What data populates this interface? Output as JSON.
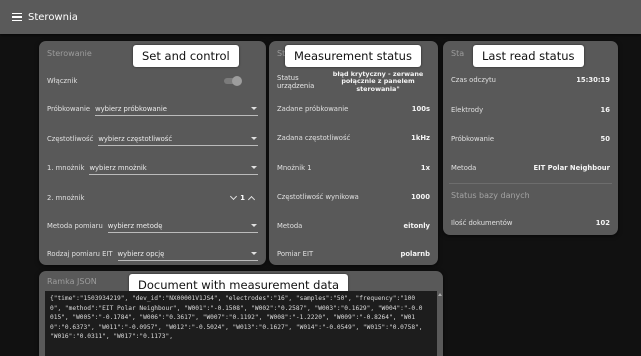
{
  "app": {
    "title": "Sterownia",
    "menu_icon": "hamburger-menu-icon"
  },
  "control": {
    "title": "Sterowanie",
    "callout": "Set and control",
    "switch_label": "Włącznik",
    "sampling_label": "Próbkowanie",
    "sampling_value": "wybierz próbkowanie",
    "frequency_label": "Częstotliwość",
    "frequency_value": "wybierz częstotliwość",
    "mult1_label": "1. mnożnik",
    "mult1_value": "wybierz mnożnik",
    "mult2_label": "2. mnożnik",
    "mult2_value": "1",
    "method_label": "Metoda pomiaru",
    "method_value": "wybierz metodę",
    "eit_label": "Rodzaj pomiaru EIT",
    "eit_value": "wybierz opcję"
  },
  "measure": {
    "title": "Stan",
    "callout": "Measurement status",
    "status_label": "Status urządzenia",
    "status_value": "błąd krytyczny - zerwane połącznie z panelem sterowania\"",
    "rows": [
      {
        "label": "Zadane próbkowanie",
        "value": "100s"
      },
      {
        "label": "Zadana częstotliwość",
        "value": "1kHz"
      },
      {
        "label": "Mnożnik 1",
        "value": "1x"
      },
      {
        "label": "Częstotliwość wynikowa",
        "value": "1000"
      },
      {
        "label": "Metoda",
        "value": "eitonly"
      },
      {
        "label": "Pomiar EIT",
        "value": "polarnb"
      }
    ]
  },
  "last": {
    "title": "Sta",
    "callout": "Last read status",
    "rows": [
      {
        "label": "Czas odczytu",
        "value": "15:30:19"
      },
      {
        "label": "Elektrody",
        "value": "16"
      },
      {
        "label": "Próbkowanie",
        "value": "50"
      },
      {
        "label": "Metoda",
        "value": "EIT Polar Neighbour"
      }
    ],
    "db_title": "Status bazy danych",
    "db_label": "Ilość dokumentów",
    "db_value": "102"
  },
  "json_panel": {
    "title": "Ramka JSON",
    "callout": "Document with measurement data",
    "content": "{\"time\":\"1503934219\", \"dev_id\":\"NX00001V1JS4\", \"electrodes\":\"16\", \"samples\":\"50\", \"frequency\":\"1000\", \"method\":\"EIT Polar Neighbour\", \"W001\":\"-0.1508\", \"W002\":\"0.2587\", \"W003\":\"0.1629\", \"W004\":\"-0.0015\", \"W005\":\"-0.1784\", \"W006\":\"0.3617\", \"W007\":\"0.1192\", \"W008\":\"-1.2220\", \"W009\":\"-0.8264\", \"W010\":\"0.6373\", \"W011\":\"-0.0957\", \"W012\":\"-0.5024\", \"W013\":\"0.1627\", \"W014\":\"-0.0549\", \"W015\":\"0.0758\", \"W016\":\"0.0311\", \"W017\":\"0.1173\","
  }
}
